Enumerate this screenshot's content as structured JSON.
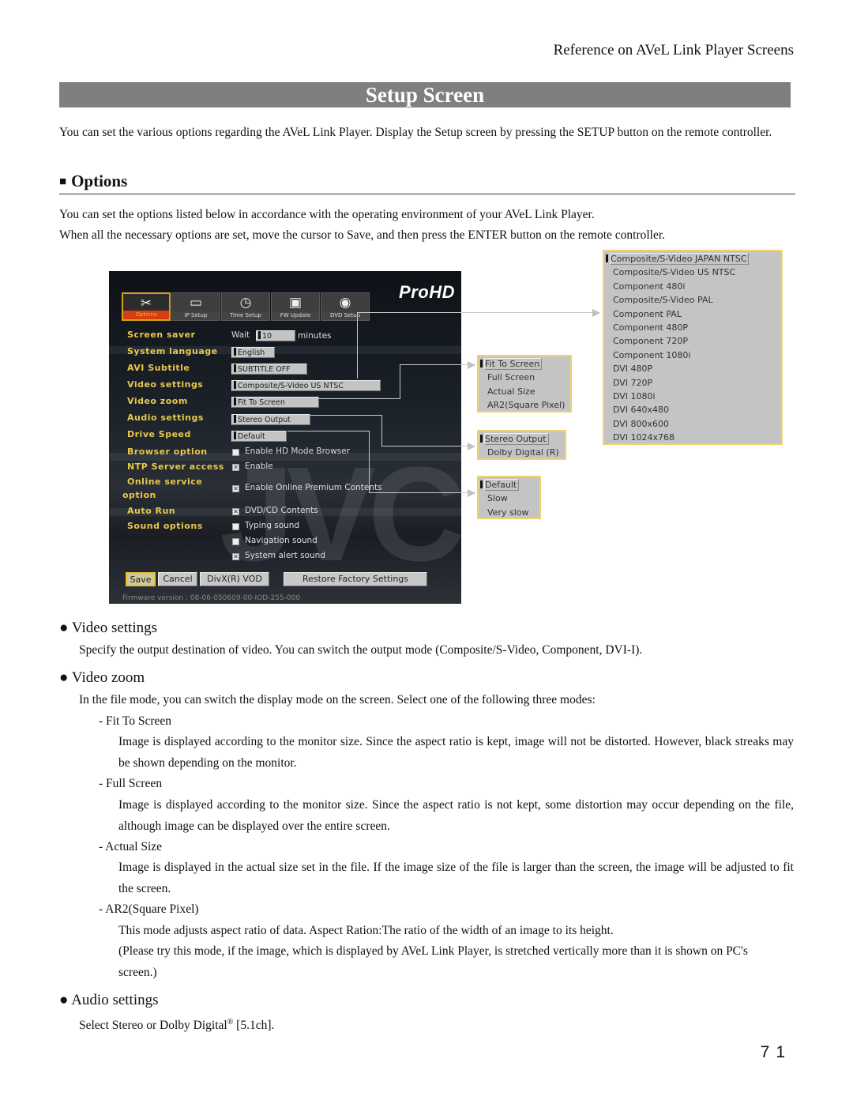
{
  "running_head": "Reference on AVeL Link Player Screens",
  "title": "Setup Screen",
  "intro": "You can set the various options regarding the AVeL Link Player. Display the Setup screen by pressing the SETUP button on the remote controller.",
  "section": {
    "marker": "■",
    "heading": "Options",
    "line1": "You can set the options listed below in accordance with the operating environment of your AVeL Link Player.",
    "line2": "When all the necessary options are set, move the cursor to Save, and then press the ENTER button on the remote controller."
  },
  "screen": {
    "logo": "ProHD",
    "watermark": "JVC",
    "tabs": [
      {
        "label": "Options",
        "icon": "tools-icon",
        "glyph": "✂",
        "active": true
      },
      {
        "label": "IP Setup",
        "icon": "network-icon",
        "glyph": "▭",
        "active": false
      },
      {
        "label": "Time Setup",
        "icon": "clock-icon",
        "glyph": "◷",
        "active": false
      },
      {
        "label": "FW Update",
        "icon": "chip-icon",
        "glyph": "▣",
        "active": false
      },
      {
        "label": "DVD Setup",
        "icon": "disc-icon",
        "glyph": "◉",
        "active": false
      }
    ],
    "rows": {
      "screen_saver": {
        "label": "Screen saver",
        "prefix": "Wait",
        "value": "10",
        "suffix": "minutes"
      },
      "system_language": {
        "label": "System language",
        "value": "English"
      },
      "avi_subtitle": {
        "label": "AVI Subtitle",
        "value": "SUBTITLE OFF"
      },
      "video_settings": {
        "label": "Video settings",
        "value": "Composite/S-Video US NTSC"
      },
      "video_zoom": {
        "label": "Video zoom",
        "value": "Fit To Screen"
      },
      "audio_settings": {
        "label": "Audio settings",
        "value": "Stereo Output"
      },
      "drive_speed": {
        "label": "Drive Speed",
        "value": "Default"
      },
      "browser_option": {
        "label": "Browser option",
        "option": "Enable HD Mode Browser",
        "checked": false
      },
      "ntp_server": {
        "label": "NTP Server access",
        "option": "Enable",
        "checked": true
      },
      "online_service": {
        "label_line1": "Online service",
        "label_line2": "option",
        "option": "Enable Online Premium Contents",
        "checked": true
      },
      "auto_run": {
        "label": "Auto Run",
        "option": "DVD/CD Contents",
        "checked": true
      },
      "sound_options": {
        "label": "Sound options",
        "items": [
          {
            "option": "Typing sound",
            "checked": false
          },
          {
            "option": "Navigation sound",
            "checked": false
          },
          {
            "option": "System alert sound",
            "checked": true
          }
        ]
      }
    },
    "checkbox_mark": "✕",
    "buttons": {
      "save": "Save",
      "cancel": "Cancel",
      "divx": "DivX(R) VOD",
      "restore": "Restore Factory Settings"
    },
    "firmware": "Firmware version : 08-06-050609-00-IOD-255-000"
  },
  "popups": {
    "video_settings": {
      "selected": "Composite/S-Video JAPAN NTSC",
      "options": [
        "Composite/S-Video JAPAN NTSC",
        "Composite/S-Video US NTSC",
        "Component 480i",
        "Composite/S-Video PAL",
        "Component PAL",
        "Component 480P",
        "Component 720P",
        "Component 1080i",
        "DVI 480P",
        "DVI 720P",
        "DVI 1080i",
        "DVI 640x480",
        "DVI 800x600",
        "DVI 1024x768"
      ]
    },
    "video_zoom": {
      "selected": "Fit To Screen",
      "options": [
        "Fit To Screen",
        "Full Screen",
        "Actual Size",
        "AR2(Square Pixel)"
      ]
    },
    "audio_settings": {
      "selected": "Stereo Output",
      "options": [
        "Stereo Output",
        "Dolby Digital (R)"
      ]
    },
    "drive_speed": {
      "selected": "Default",
      "options": [
        "Default",
        "Slow",
        "Very slow"
      ]
    }
  },
  "descriptions": {
    "bullet": "●",
    "video_settings": {
      "heading": "Video settings",
      "text": "Specify the output destination of video. You can switch the output mode (Composite/S-Video, Component, DVI-I)."
    },
    "video_zoom": {
      "heading": "Video zoom",
      "text": "In the file mode, you can switch the display mode on the screen. Select one of the following three modes:",
      "modes": [
        {
          "name": "- Fit To Screen",
          "text": "Image is displayed according to the monitor size. Since the aspect ratio is kept, image will not be distorted. However, black streaks may be shown depending on the monitor."
        },
        {
          "name": "- Full Screen",
          "text": "Image is displayed according to the monitor size. Since the aspect ratio is not kept, some distortion may occur depending on the file, although image can be displayed over the entire screen."
        },
        {
          "name": "- Actual Size",
          "text": "Image is displayed in the actual size set in the file. If the image size of the file is larger than the screen, the image will be adjusted to fit the screen."
        },
        {
          "name": "- AR2(Square Pixel)",
          "text": "This mode adjusts aspect ratio of data. Aspect Ration:The ratio of the width of an image to its height.",
          "note": "(Please try this mode, if the image, which is displayed by AVeL Link Player, is stretched vertically more than it is shown on PC's screen.)"
        }
      ]
    },
    "audio_settings": {
      "heading": "Audio settings",
      "text_before": "Select Stereo or Dolby Digital",
      "sup": "®",
      "text_after": " [5.1ch]."
    }
  },
  "page_number": "71"
}
